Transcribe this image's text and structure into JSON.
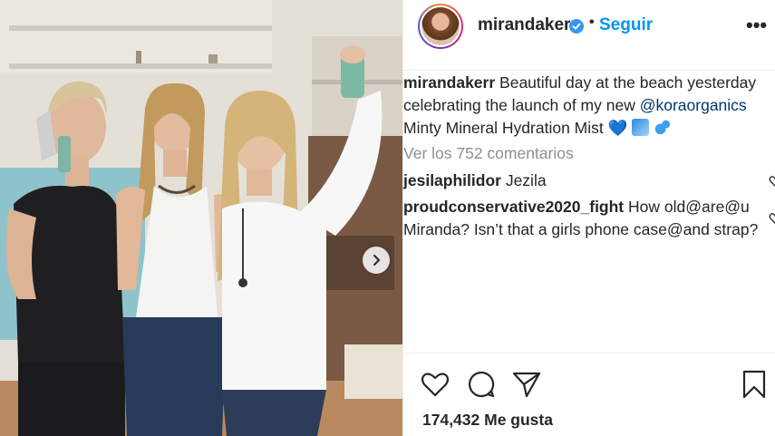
{
  "post": {
    "username": "mirandakerr",
    "follow_label": "Seguir",
    "dot": "•",
    "more_label": "•••",
    "caption_user": "mirandakerr",
    "caption_line1": "Beautiful day at the beach yesterday",
    "caption_line2": "celebrating the launch of my new",
    "caption_mention": "@koraorganics",
    "caption_line3": "Minty Mineral Hydration Mist",
    "caption_heart": "💙",
    "view_comments": "Ver los 752 comentarios",
    "likes": "174,432 Me gusta"
  },
  "comments": [
    {
      "user": "jesilaphilidor",
      "text": "Jezila"
    },
    {
      "user": "proudconservative2020_fight",
      "text": "How old@are@u",
      "text2": "Miranda? Isn’t that a girls phone case@and strap?"
    }
  ],
  "colors": {
    "accent": "#0095f6",
    "verified": "#3897f0",
    "mention": "#00376b",
    "muted": "#8e8e8e"
  },
  "icons": [
    "verified-badge-icon",
    "more-options-icon",
    "chevron-right-icon",
    "heart-icon",
    "comment-icon",
    "share-icon",
    "bookmark-icon"
  ]
}
